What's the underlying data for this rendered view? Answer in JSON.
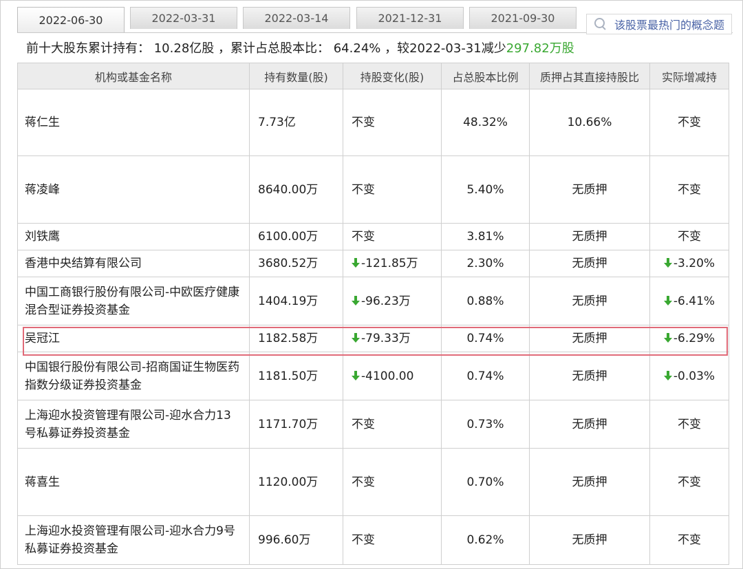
{
  "tabs": [
    "2022-06-30",
    "2022-03-31",
    "2022-03-14",
    "2021-12-31",
    "2021-09-30"
  ],
  "search": {
    "label": "该股票最热门的概念题"
  },
  "summary": {
    "prefix": "前十大股东累计持有：",
    "total": "10.28亿股",
    "ratio_label": "，累计占总股本比：",
    "ratio": "64.24%",
    "compare": "，较2022-03-31减少",
    "change": "297.82万股"
  },
  "columns": [
    "机构或基金名称",
    "持有数量(股)",
    "持股变化(股)",
    "占总股本比例",
    "质押占其直接持股比",
    "实际增减持"
  ],
  "rows": [
    {
      "name": "蒋仁生",
      "qty": "7.73亿",
      "change": "不变",
      "change_down": false,
      "ratio": "48.32%",
      "pledge": "10.66%",
      "actual": "不变",
      "actual_down": false
    },
    {
      "name": "蒋凌峰",
      "qty": "8640.00万",
      "change": "不变",
      "change_down": false,
      "ratio": "5.40%",
      "pledge": "无质押",
      "actual": "不变",
      "actual_down": false
    },
    {
      "name": "刘铁鹰",
      "qty": "6100.00万",
      "change": "不变",
      "change_down": false,
      "ratio": "3.81%",
      "pledge": "无质押",
      "actual": "不变",
      "actual_down": false
    },
    {
      "name": "香港中央结算有限公司",
      "qty": "3680.52万",
      "change": "-121.85万",
      "change_down": true,
      "ratio": "2.30%",
      "pledge": "无质押",
      "actual": "-3.20%",
      "actual_down": true
    },
    {
      "name": "中国工商银行股份有限公司-中欧医疗健康混合型证券投资基金",
      "qty": "1404.19万",
      "change": "-96.23万",
      "change_down": true,
      "ratio": "0.88%",
      "pledge": "无质押",
      "actual": "-6.41%",
      "actual_down": true
    },
    {
      "name": "吴冠江",
      "qty": "1182.58万",
      "change": "-79.33万",
      "change_down": true,
      "ratio": "0.74%",
      "pledge": "无质押",
      "actual": "-6.29%",
      "actual_down": true
    },
    {
      "name": "中国银行股份有限公司-招商国证生物医药指数分级证券投资基金",
      "qty": "1181.50万",
      "change": "-4100.00",
      "change_down": true,
      "ratio": "0.74%",
      "pledge": "无质押",
      "actual": "-0.03%",
      "actual_down": true
    },
    {
      "name": "上海迎水投资管理有限公司-迎水合力13号私募证券投资基金",
      "qty": "1171.70万",
      "change": "不变",
      "change_down": false,
      "ratio": "0.73%",
      "pledge": "无质押",
      "actual": "不变",
      "actual_down": false
    },
    {
      "name": "蒋喜生",
      "qty": "1120.00万",
      "change": "不变",
      "change_down": false,
      "ratio": "0.70%",
      "pledge": "无质押",
      "actual": "不变",
      "actual_down": false
    },
    {
      "name": "上海迎水投资管理有限公司-迎水合力9号私募证券投资基金",
      "qty": "996.60万",
      "change": "不变",
      "change_down": false,
      "ratio": "0.62%",
      "pledge": "无质押",
      "actual": "不变",
      "actual_down": false
    }
  ],
  "colors": {
    "green": "#3aa832",
    "highlight": "#e06a78"
  }
}
